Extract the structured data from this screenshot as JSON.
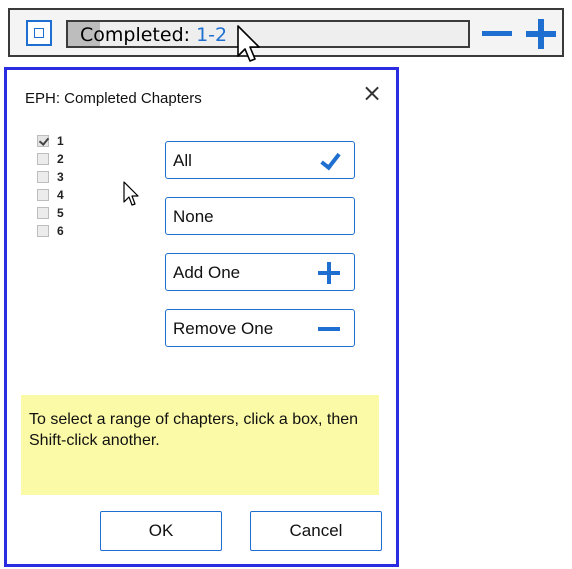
{
  "topbar": {
    "progress_label": "Completed:",
    "progress_value": "1-2",
    "progress_fraction": 0.08
  },
  "dialog": {
    "title": "EPH: Completed Chapters",
    "close_glyph": "×",
    "chapters": [
      {
        "label": "1",
        "checked": true
      },
      {
        "label": "2",
        "checked": false
      },
      {
        "label": "3",
        "checked": false
      },
      {
        "label": "4",
        "checked": false
      },
      {
        "label": "5",
        "checked": false
      },
      {
        "label": "6",
        "checked": false
      }
    ],
    "buttons": {
      "all": "All",
      "none": "None",
      "add_one": "Add One",
      "remove_one": "Remove One"
    },
    "hint": "To select a range of chapters, click a box, then Shift-click another.",
    "ok": "OK",
    "cancel": "Cancel"
  },
  "colors": {
    "accent": "#1f6fd1",
    "dialog_border": "#2b2be0",
    "hint_bg": "#fbfaa6"
  },
  "icons": {
    "all": "check-icon",
    "add_one": "plus-icon",
    "remove_one": "minus-icon"
  }
}
